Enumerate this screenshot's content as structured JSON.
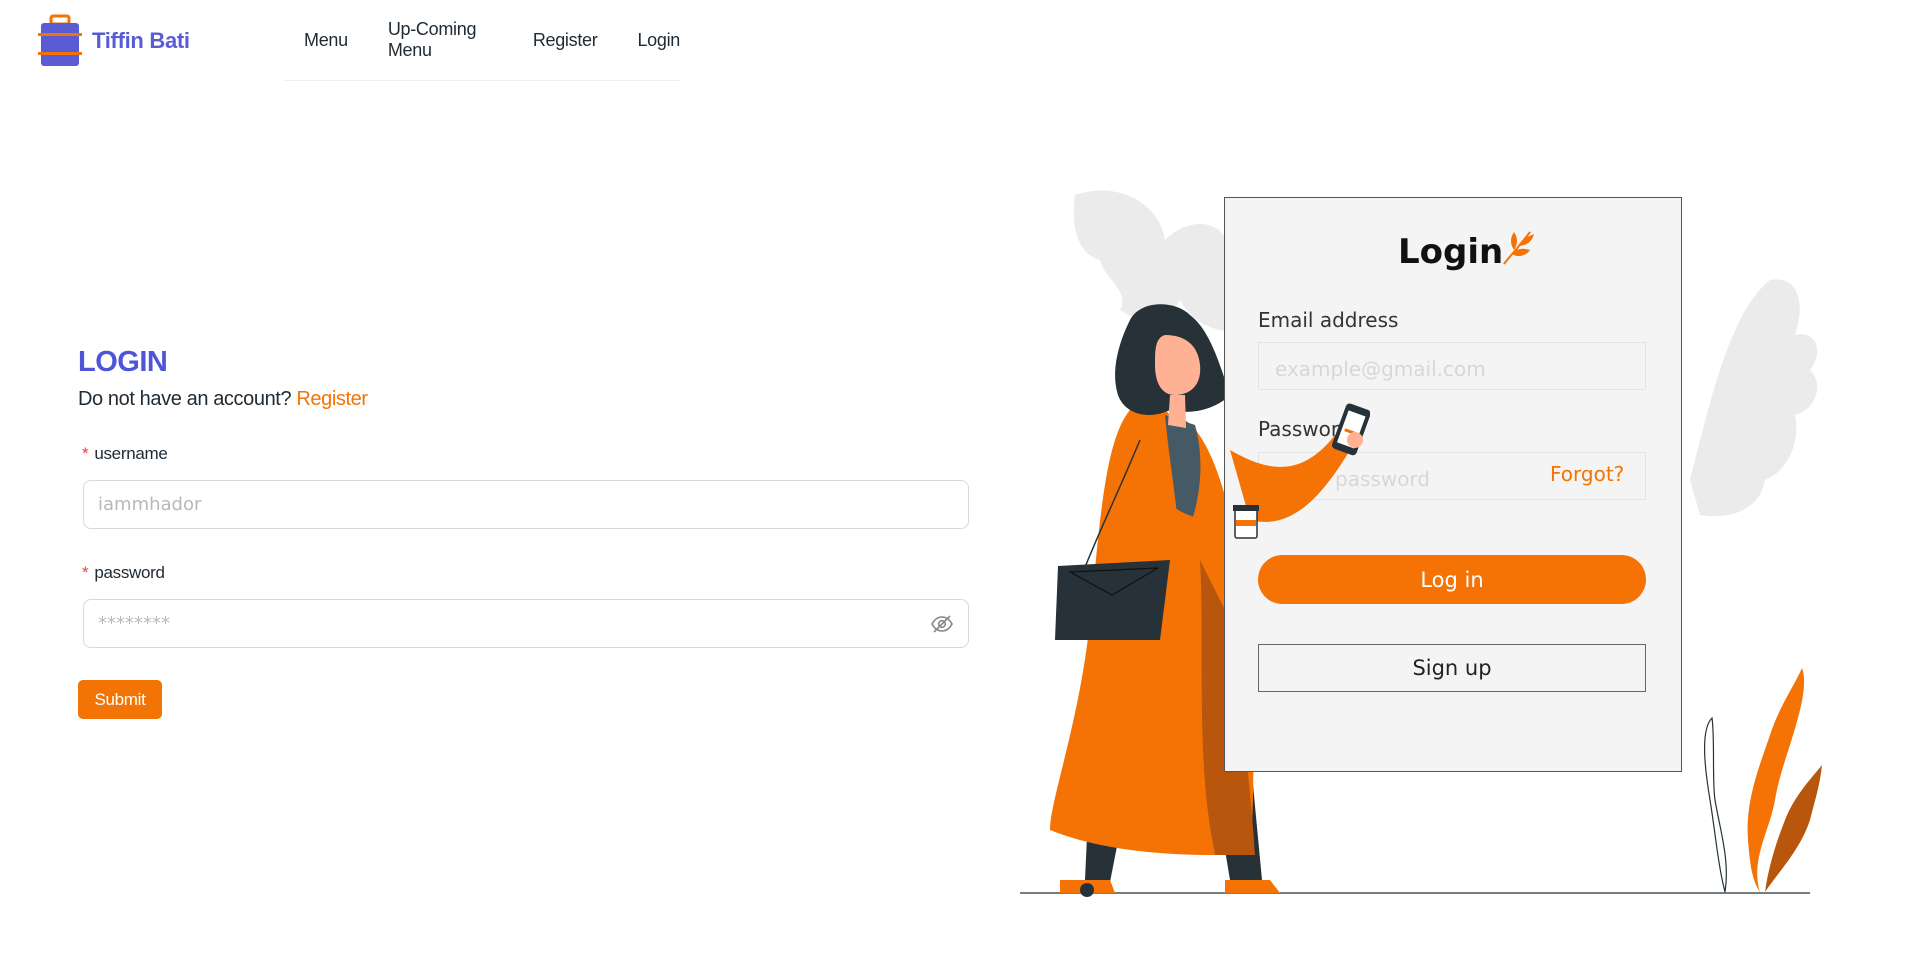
{
  "brand": {
    "name": "Tiffin Bati",
    "icon": "lunchbox-icon",
    "color": "#5a5cd6",
    "accent": "#f27405"
  },
  "nav": {
    "items": [
      "Menu",
      "Up-Coming Menu",
      "Register",
      "Login"
    ]
  },
  "form": {
    "title": "LOGIN",
    "account_text": "Do not have an account?",
    "register_link": "Register",
    "required_mark": "*",
    "username_label": "username",
    "username_placeholder": "iammhador",
    "password_label": "password",
    "password_placeholder": "********",
    "password_toggle_icon": "eye-slash-icon",
    "submit_label": "Submit"
  },
  "illustration": {
    "card_title": "Login",
    "email_label": "Email address",
    "email_placeholder": "example@gmail.com",
    "password_label": "Password",
    "password_placeholder": "Enter password",
    "forgot_label": "Forgot?",
    "login_button": "Log in",
    "signup_button": "Sign up"
  },
  "colors": {
    "primary": "#4f55d9",
    "orange": "#f27405",
    "dark": "#263238"
  }
}
